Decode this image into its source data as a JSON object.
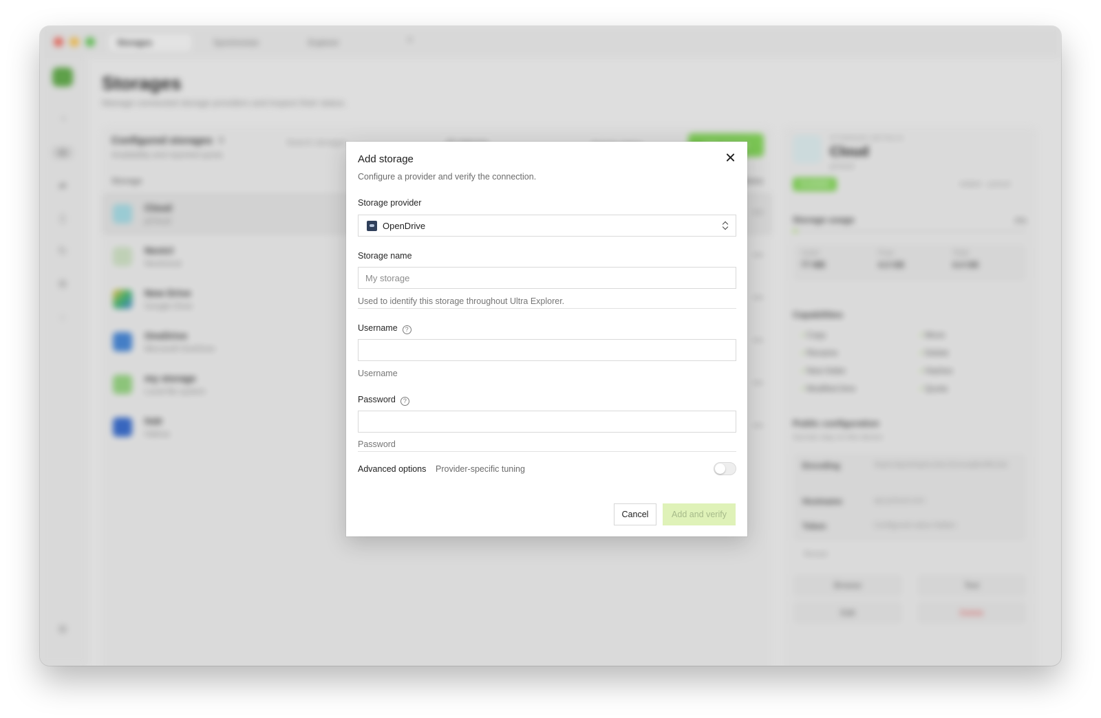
{
  "window": {
    "tabs": [
      {
        "label": "Storages"
      },
      {
        "label": "Synchronize"
      },
      {
        "label": "Explorer"
      }
    ],
    "tab_add": "+"
  },
  "page": {
    "title": "Storages",
    "subtitle": "Manage connected storage providers and inspect their status."
  },
  "list": {
    "title": "Configured storages",
    "count": "6",
    "subtitle": "Availability and reported quota",
    "search_placeholder": "Search storages",
    "filter": "All statuses",
    "secondary_action": "Sort by status",
    "primary_action": "Add storage",
    "col_storage": "Storage",
    "col_actions": "Actions",
    "rows": [
      {
        "name": "Cloud",
        "sub": "pCloud",
        "color": "#9fd6e0"
      },
      {
        "name": "Nextcl",
        "sub": "Nextcloud",
        "color": "#c9dcbf"
      },
      {
        "name": "New Drive",
        "sub": "Google Drive",
        "color": "#f3c13a"
      },
      {
        "name": "OneDrive",
        "sub": "Microsoft OneDrive",
        "color": "#3d7fd1"
      },
      {
        "name": "my storage",
        "sub": "Local file system",
        "color": "#8fcf7a"
      },
      {
        "name": "hidr",
        "sub": "Hidrive",
        "color": "#2f64c8"
      }
    ],
    "more": "•••"
  },
  "detail": {
    "kicker": "STORAGE DETAILS",
    "name": "Cloud",
    "id": "pCloud",
    "status": "Available",
    "meta": "Added · pcloud",
    "usage_title": "Storage usage",
    "usage_pct": "0%",
    "usage_fraction": 0.02,
    "used_label": "Used",
    "used": "77 MB",
    "free_label": "Free",
    "free": "4.3 GB",
    "total_label": "Total",
    "total": "4.4 GB",
    "capabilities_title": "Capabilities",
    "capabilities": [
      "Copy",
      "Move",
      "Rename",
      "Delete",
      "New folder",
      "Hashes",
      "Modified time",
      "Quota"
    ],
    "config_title": "Public configuration",
    "config_sub": "Secrets stay on this device",
    "config": [
      {
        "key": "Encoding",
        "value": "Slash,BackSlash,Del,Ctl,InvalidUtf8,Dot"
      },
      {
        "key": "Hostname",
        "value": "api.pcloud.com"
      },
      {
        "key": "Token",
        "value": "Configured value hidden"
      }
    ],
    "reveal": "Reveal",
    "actions": {
      "browse": "Browse",
      "test": "Test",
      "edit": "Edit",
      "delete": "Delete"
    }
  },
  "dialog": {
    "title": "Add storage",
    "subtitle": "Configure a provider and verify the connection.",
    "provider_label": "Storage provider",
    "provider_value": "OpenDrive",
    "name_label": "Storage name",
    "name_placeholder": "My storage",
    "name_value": "",
    "name_hint": "Used to identify this storage throughout Ultra Explorer.",
    "username_label": "Username",
    "username_value": "",
    "username_hint": "Username",
    "password_label": "Password",
    "password_value": "",
    "password_hint": "Password",
    "advanced_label": "Advanced options",
    "advanced_sub": "Provider-specific tuning",
    "advanced_enabled": false,
    "cancel": "Cancel",
    "submit": "Add and verify",
    "accent_color": "#dff2b8"
  }
}
